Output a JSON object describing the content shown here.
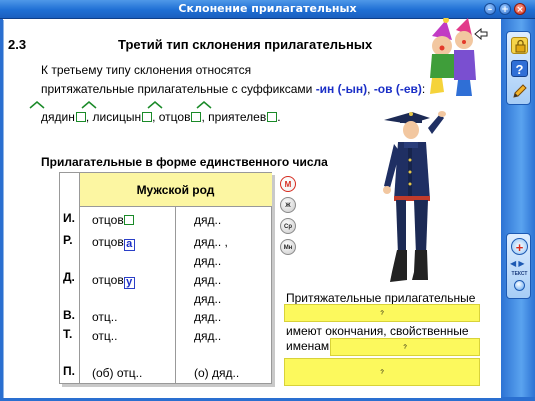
{
  "window": {
    "title": "Склонение прилагательных",
    "buttons": {
      "minimize": "–",
      "maximize": "+",
      "close": "×"
    }
  },
  "section": {
    "number": "2.3",
    "title": "Третий тип склонения прилагательных"
  },
  "intro": {
    "line1": "К третьему типу склонения относятся",
    "line2_prefix": "притяжательные прилагательные с суффиксами ",
    "suffix1": "-ин (-ын)",
    "sep": ", ",
    "suffix2": "-ов (-ев)",
    "colon": ":"
  },
  "examples": {
    "w1": "дядин",
    "w2": "лисицын",
    "w3": "отцов",
    "w4": "приятелев",
    "comma": ",",
    "dot": "."
  },
  "subheading": "Прилагательные в форме единственного числа",
  "table": {
    "header": "Мужской род",
    "rows": [
      {
        "case": "И.",
        "col1": "отцов",
        "col1_box": "",
        "col2": "дяд.."
      },
      {
        "case": "Р.",
        "col1": "отцов",
        "col1_box": "а",
        "col2": "дяд.. ,"
      },
      {
        "case": "",
        "col1": "",
        "col1_box": "",
        "col2": "дяд.."
      },
      {
        "case": "Д.",
        "col1": "отцов",
        "col1_box": "у",
        "col2": "дяд.."
      },
      {
        "case": "",
        "col1": "",
        "col1_box": "",
        "col2": "дяд.."
      },
      {
        "case": "В.",
        "col1": "отц..",
        "col1_box": "",
        "col2": "дяд.."
      },
      {
        "case": "Т.",
        "col1": "отц..",
        "col1_box": "",
        "col2": "дяд.."
      },
      {
        "case": "П.",
        "col1": "(об) отц..",
        "col1_box": "",
        "col2": "(о) дяд.."
      }
    ]
  },
  "gender_buttons": [
    {
      "label": "М",
      "active": true
    },
    {
      "label": "Ж",
      "active": false
    },
    {
      "label": "Ср",
      "active": false
    },
    {
      "label": "Мн",
      "active": false
    }
  ],
  "right_panel": {
    "line1": "Притяжательные прилагательные",
    "box1": "?",
    "line2": "имеют окончания, свойственные",
    "line3": "именам",
    "box2": "?",
    "box3": "?"
  },
  "sidebar": {
    "tools": [
      "lock-icon",
      "help-icon",
      "pencil-icon"
    ],
    "bottom": {
      "zoom": "+",
      "label": "ТЕКСТ"
    }
  }
}
